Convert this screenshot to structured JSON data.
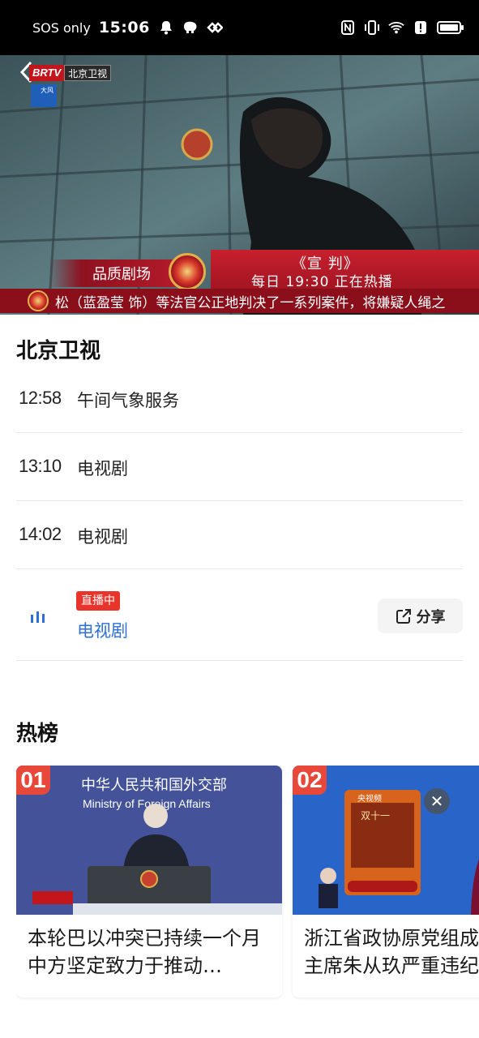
{
  "status_bar": {
    "carrier": "SOS only",
    "time": "15:06",
    "left_icons": [
      "bell-icon",
      "elephant-icon",
      "vpn-icon"
    ],
    "right_icons": [
      "nfc-icon",
      "vibrate-icon",
      "wifi-icon",
      "alert-icon",
      "battery-icon"
    ]
  },
  "player": {
    "logo_brand": "BRTV",
    "logo_channel": "北京卫视",
    "bug_text": "大风",
    "banner_left": "品质剧场",
    "show_title": "《宣 判》",
    "show_time": "每日 19:30 正在热播",
    "ticker": "松（蓝盈莹 饰）等法官公正地判决了一系列案件，将嫌疑人绳之"
  },
  "channel": {
    "title": "北京卫视"
  },
  "schedule": [
    {
      "time": "12:58",
      "name": "午间气象服务"
    },
    {
      "time": "13:10",
      "name": "电视剧"
    },
    {
      "time": "14:02",
      "name": "电视剧"
    }
  ],
  "live_item": {
    "badge": "直播中",
    "name": "电视剧",
    "share_label": "分享"
  },
  "hot": {
    "title": "热榜",
    "cards": [
      {
        "rank": "01",
        "text": "本轮巴以冲突已持续一个月 中方坚定致力于推动…"
      },
      {
        "rank": "02",
        "text": "浙江省政协原党组成员、副主席朱从玖严重违纪"
      }
    ]
  },
  "colors": {
    "accent_blue": "#2e6fd8",
    "live_red": "#e8342a",
    "rank_red": "#e8483a"
  }
}
